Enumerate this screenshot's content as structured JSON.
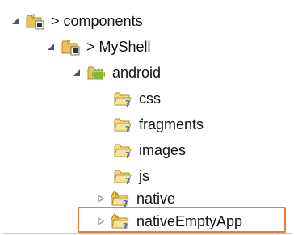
{
  "tree": {
    "rows": [
      {
        "label": "components",
        "prefix": "> ",
        "type": "project-folder",
        "expanded": true
      },
      {
        "label": "MyShell",
        "prefix": "> ",
        "type": "project-folder",
        "expanded": true
      },
      {
        "label": "android",
        "prefix": "",
        "type": "android",
        "expanded": true
      },
      {
        "label": "css",
        "prefix": "",
        "type": "folder-q"
      },
      {
        "label": "fragments",
        "prefix": "",
        "type": "folder-q"
      },
      {
        "label": "images",
        "prefix": "",
        "type": "folder-q"
      },
      {
        "label": "js",
        "prefix": "",
        "type": "folder-q"
      },
      {
        "label": "native",
        "prefix": "",
        "type": "folder-warn",
        "expanded": false
      },
      {
        "label": "nativeEmptyApp",
        "prefix": "",
        "type": "folder-warn",
        "expanded": false,
        "highlighted": true
      }
    ]
  },
  "colors": {
    "highlight": "#ee7a33",
    "folder": "#e8c35a",
    "android": "#86b53a",
    "question": "#3a6fd8"
  }
}
